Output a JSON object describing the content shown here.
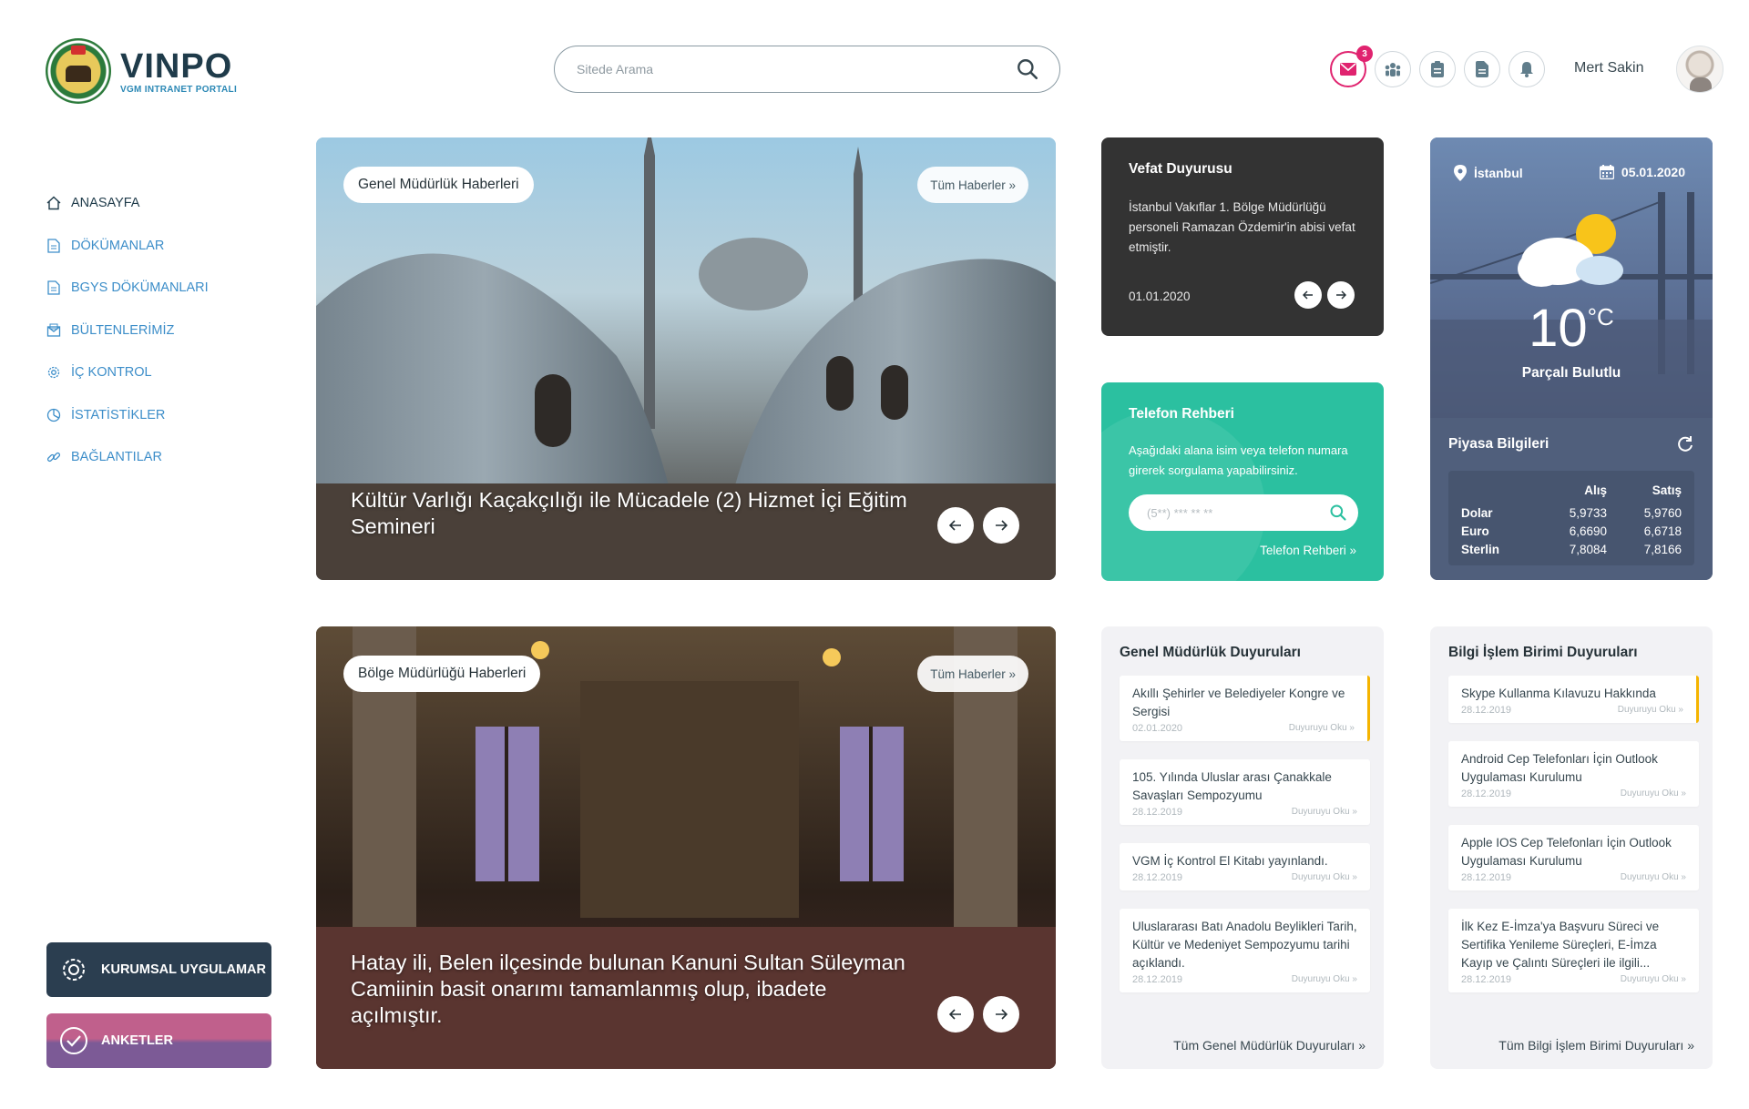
{
  "brand": {
    "name": "VINPO",
    "subtitle": "VGM INTRANET PORTALI"
  },
  "search": {
    "placeholder": "Sitede Arama"
  },
  "header": {
    "mail_badge": "3",
    "user_name": "Mert Sakin"
  },
  "sidebar": {
    "items": [
      {
        "label": "ANASAYFA",
        "icon": "home-icon"
      },
      {
        "label": "DÖKÜMANLAR",
        "icon": "document-icon"
      },
      {
        "label": "BGYS DÖKÜMANLARI",
        "icon": "document-icon"
      },
      {
        "label": "BÜLTENLERİMİZ",
        "icon": "newsletter-icon"
      },
      {
        "label": "İÇ KONTROL",
        "icon": "gear-icon"
      },
      {
        "label": "İSTATİSTİKLER",
        "icon": "chart-icon"
      },
      {
        "label": "BAĞLANTILAR",
        "icon": "link-icon"
      }
    ],
    "kurumsal_label": "KURUMSAL UYGULAMAR",
    "anketler_label": "ANKETLER"
  },
  "hero1": {
    "category": "Genel Müdürlük Haberleri",
    "all_link": "Tüm Haberler »",
    "headline": "Kültür Varlığı Kaçakçılığı ile Mücadele (2) Hizmet İçi Eğitim Semineri"
  },
  "hero2": {
    "category": "Bölge Müdürlüğü Haberleri",
    "all_link": "Tüm Haberler »",
    "headline": "Hatay ili, Belen ilçesinde bulunan Kanuni Sultan Süleyman Camiinin basit onarımı tamamlanmış olup, ibadete açılmıştır."
  },
  "vefat": {
    "title": "Vefat Duyurusu",
    "body": "İstanbul Vakıflar 1. Bölge Müdürlüğü personeli Ramazan Özdemir'in abisi vefat etmiştir.",
    "date": "01.01.2020"
  },
  "telefon": {
    "title": "Telefon Rehberi",
    "body": "Aşağıdaki alana isim veya telefon numara girerek sorgulama yapabilirsiniz.",
    "placeholder": "(5**) *** ** **",
    "link": "Telefon Rehberi »"
  },
  "weather": {
    "city": "İstanbul",
    "date": "05.01.2020",
    "temp": "10",
    "unit": "°C",
    "condition": "Parçalı Bulutlu",
    "market_title": "Piyasa Bilgileri",
    "col_buy": "Alış",
    "col_sell": "Satış",
    "rates": [
      {
        "name": "Dolar",
        "buy": "5,9733",
        "sell": "5,9760"
      },
      {
        "name": "Euro",
        "buy": "6,6690",
        "sell": "6,6718"
      },
      {
        "name": "Sterlin",
        "buy": "7,8084",
        "sell": "7,8166"
      }
    ]
  },
  "ann_gm": {
    "title": "Genel Müdürlük Duyuruları",
    "read_label": "Duyuruyu Oku »",
    "all_link": "Tüm Genel Müdürlük Duyuruları »",
    "items": [
      {
        "title": "Akıllı Şehirler ve Belediyeler Kongre ve Sergisi",
        "date": "02.01.2020"
      },
      {
        "title": "105. Yılında Uluslar arası Çanakkale Savaşları Sempozyumu",
        "date": "28.12.2019"
      },
      {
        "title": "VGM İç Kontrol El Kitabı yayınlandı.",
        "date": "28.12.2019"
      },
      {
        "title": "Uluslararası Batı Anadolu Beylikleri Tarih, Kültür ve Medeniyet Sempozyumu tarihi açıklandı.",
        "date": "28.12.2019"
      }
    ]
  },
  "ann_bi": {
    "title": "Bilgi İşlem Birimi Duyuruları",
    "read_label": "Duyuruyu Oku »",
    "all_link": "Tüm Bilgi İşlem Birimi Duyuruları »",
    "items": [
      {
        "title": "Skype Kullanma Kılavuzu Hakkında",
        "date": "28.12.2019"
      },
      {
        "title": "Android Cep Telefonları İçin Outlook Uygulaması Kurulumu",
        "date": "28.12.2019"
      },
      {
        "title": "Apple IOS Cep Telefonları İçin Outlook Uygulaması Kurulumu",
        "date": "28.12.2019"
      },
      {
        "title": "İlk Kez E-İmza'ya Başvuru Süreci ve Sertifika Yenileme Süreçleri, E-İmza Kayıp ve Çalıntı Süreçleri ile ilgili...",
        "date": "28.12.2019"
      }
    ]
  },
  "colors": {
    "accent_pink": "#e0236f",
    "nav_blue": "#3d8ec9",
    "teal": "#2bc0a0",
    "dark": "#333333",
    "gold": "#f5b400"
  }
}
